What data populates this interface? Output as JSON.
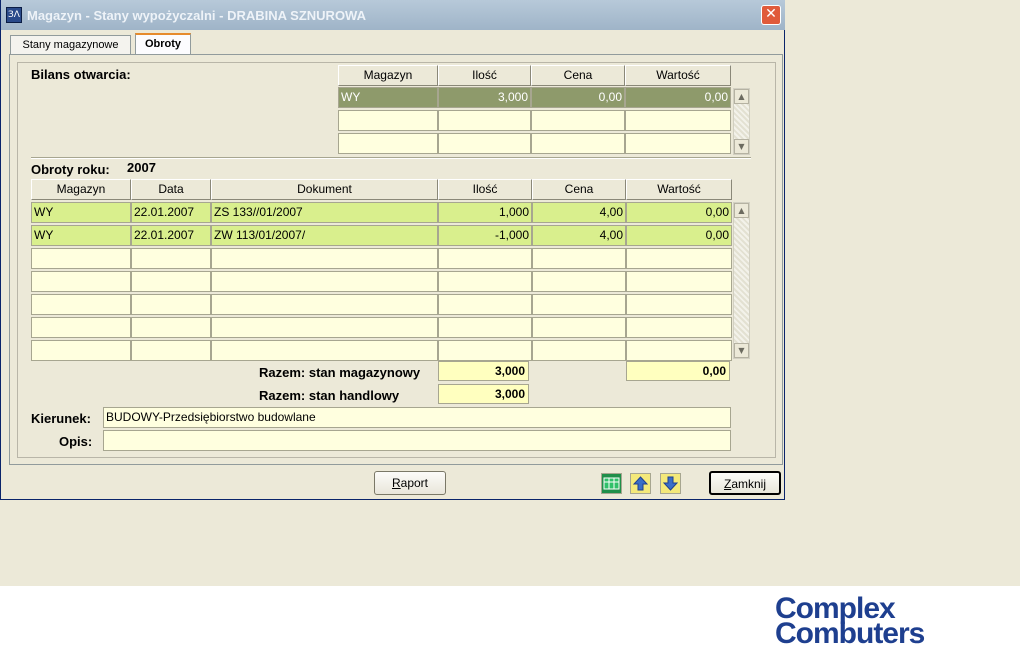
{
  "window": {
    "title": "Magazyn - Stany wypożyczalni - DRABINA SZNUROWA",
    "close_glyph": "✕",
    "app_icon_text": "ЗΛ"
  },
  "tabs": [
    {
      "label": "Stany magazynowe",
      "active": false
    },
    {
      "label": "Obroty",
      "active": true
    }
  ],
  "opening_balance": {
    "label": "Bilans otwarcia:",
    "columns": [
      "Magazyn",
      "Ilość",
      "Cena",
      "Wartość"
    ],
    "rows": [
      [
        "WY",
        "3,000",
        "0,00",
        "0,00"
      ],
      [
        "",
        "",
        "",
        ""
      ],
      [
        "",
        "",
        "",
        ""
      ]
    ]
  },
  "turnover": {
    "label": "Obroty roku:",
    "year": "2007",
    "columns": [
      "Magazyn",
      "Data",
      "Dokument",
      "Ilość",
      "Cena",
      "Wartość"
    ],
    "rows": [
      [
        "WY",
        "22.01.2007",
        "ZS 133//01/2007",
        "1,000",
        "4,00",
        "0,00"
      ],
      [
        "WY",
        "22.01.2007",
        "ZW 113/01/2007/",
        "-1,000",
        "4,00",
        "0,00"
      ],
      [
        "",
        "",
        "",
        "",
        "",
        ""
      ],
      [
        "",
        "",
        "",
        "",
        "",
        ""
      ],
      [
        "",
        "",
        "",
        "",
        "",
        ""
      ],
      [
        "",
        "",
        "",
        "",
        "",
        ""
      ],
      [
        "",
        "",
        "",
        "",
        "",
        ""
      ]
    ]
  },
  "totals": {
    "stock_label": "Razem: stan magazynowy",
    "stock_qty": "3,000",
    "stock_value": "0,00",
    "trade_label": "Razem: stan handlowy",
    "trade_qty": "3,000"
  },
  "fields": {
    "kierunek_label": "Kierunek:",
    "kierunek_value": "BUDOWY-Przedsiębiorstwo budowlane",
    "opis_label": "Opis:",
    "opis_value": ""
  },
  "buttons": {
    "raport_first": "R",
    "raport_rest": "aport",
    "zamknij_first": "Z",
    "zamknij_rest": "amknij"
  },
  "icons": [
    "table-icon",
    "up-arrow-icon",
    "down-arrow-icon"
  ],
  "logo": {
    "line1": "Complex",
    "line2": "Combuters"
  },
  "colors": {
    "row_highlight": "#d9ef8d",
    "selected_row": "#8e9a6b",
    "cell_background": "#ffffdf",
    "logo": "#1e3f8f"
  }
}
